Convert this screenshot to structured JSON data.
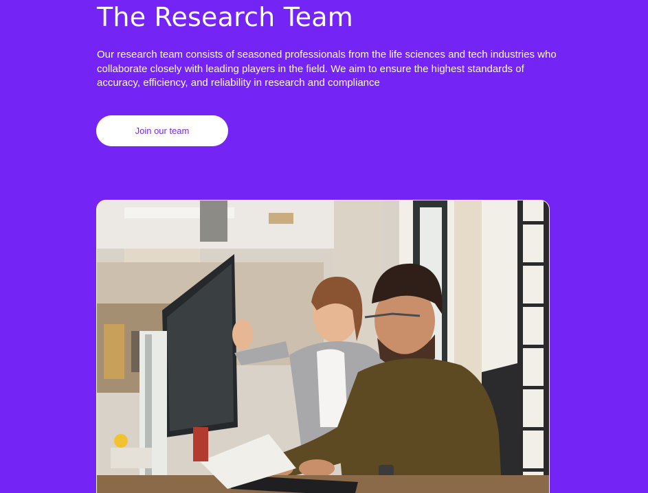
{
  "section": {
    "title": "The Research Team",
    "description": "Our research team consists of seasoned professionals from the life sciences and tech industries who collaborate closely with leading players in the field. We aim to ensure the highest standards of accuracy, efficiency, and reliability in research and compliance",
    "cta_label": "Join our team"
  },
  "colors": {
    "background": "#7424f4",
    "text": "#ffffff",
    "button_bg": "#ffffff",
    "button_text": "#7424f4"
  },
  "image": {
    "subject": "team-photo"
  }
}
